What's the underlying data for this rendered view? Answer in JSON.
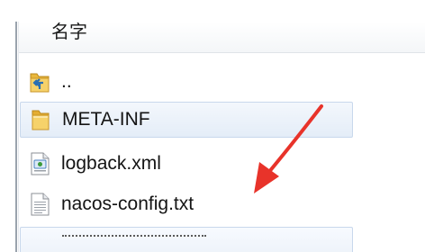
{
  "header": {
    "column_name": "名字"
  },
  "files": [
    {
      "name": "..",
      "icon": "folder-up-icon",
      "highlighted": false
    },
    {
      "name": "META-INF",
      "icon": "folder-icon",
      "highlighted": true
    },
    {
      "name": "logback.xml",
      "icon": "xml-file-icon",
      "highlighted": false
    },
    {
      "name": "nacos-config.txt",
      "icon": "text-file-icon",
      "highlighted": false
    }
  ],
  "annotation": {
    "arrow_color": "#e8332a"
  },
  "colors": {
    "folder": "#f0c24a",
    "highlight": "#e4edf8"
  }
}
